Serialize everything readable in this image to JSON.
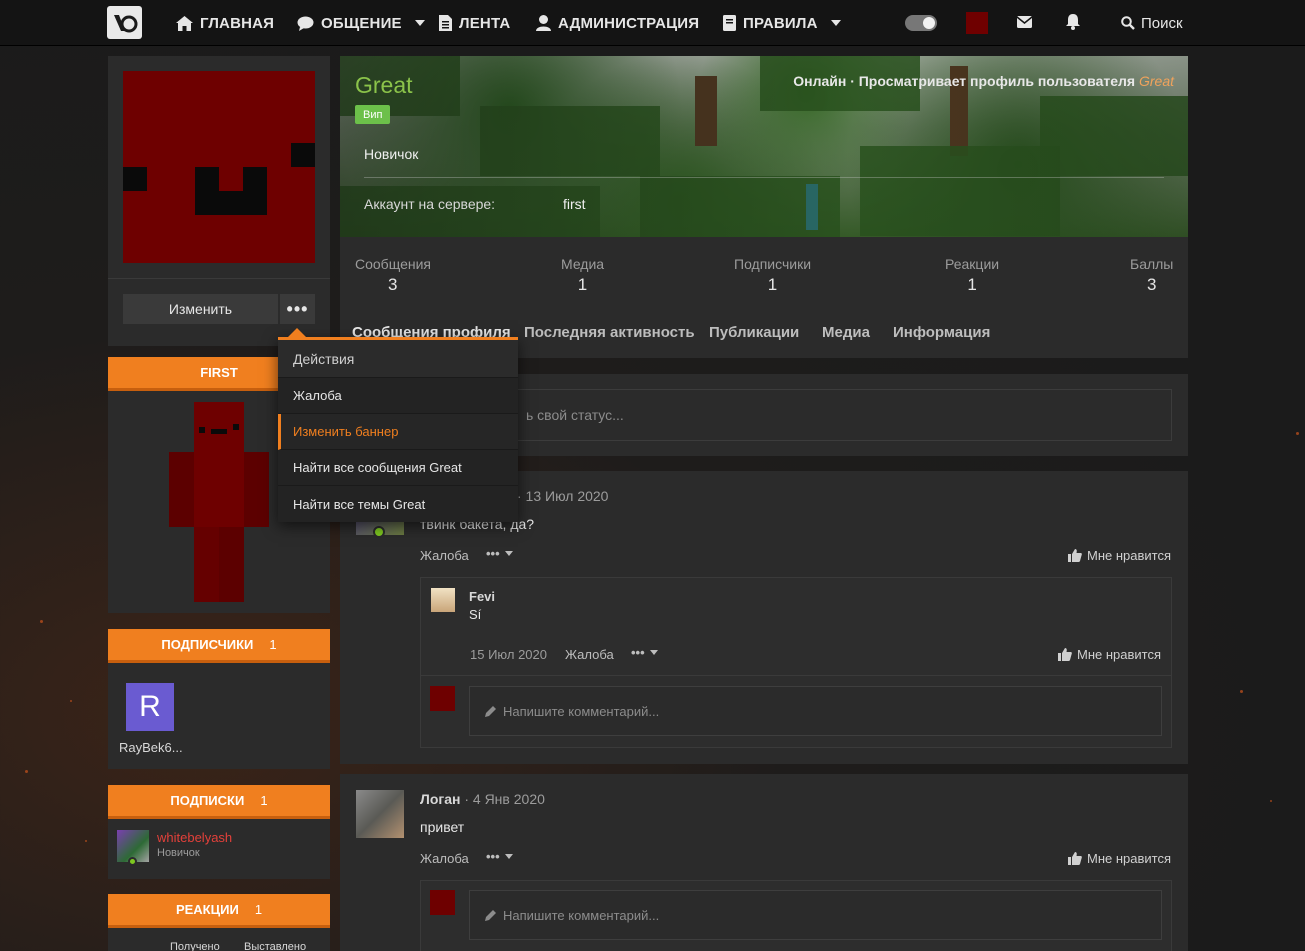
{
  "nav": {
    "home": "ГЛАВНАЯ",
    "chat": "ОБЩЕНИЕ",
    "feed": "ЛЕНТА",
    "admin": "АДМИНИСТРАЦИЯ",
    "rules": "ПРАВИЛА",
    "search": "Поиск"
  },
  "profile": {
    "username": "Great",
    "badge": "Вип",
    "rank": "Новичок",
    "online_prefix": "Онлайн · Просматривает профиль пользователя",
    "online_user": "Great",
    "server_label": "Аккаунт на сервере:",
    "server_value": "first",
    "edit_button": "Изменить",
    "more_button": "•••"
  },
  "stats": [
    {
      "label": "Сообщения",
      "value": "3"
    },
    {
      "label": "Медиа",
      "value": "1"
    },
    {
      "label": "Подписчики",
      "value": "1"
    },
    {
      "label": "Реакции",
      "value": "1"
    },
    {
      "label": "Баллы",
      "value": "3"
    }
  ],
  "tabs": [
    "Сообщения профиля",
    "Последняя активность",
    "Публикации",
    "Медиа",
    "Информация"
  ],
  "dropdown": {
    "header": "Действия",
    "items": [
      "Жалоба",
      "Изменить баннер",
      "Найти все сообщения Great",
      "Найти все темы Great"
    ]
  },
  "sidebar": {
    "skin_title": "FIRST",
    "followers_title": "ПОДПИСЧИКИ",
    "followers_count": "1",
    "follower_letter": "R",
    "follower_name": "RayBek6...",
    "following_title": "ПОДПИСКИ",
    "following_count": "1",
    "following_name": "whitebelyash",
    "following_rank": "Новичок",
    "reactions_title": "РЕАКЦИИ",
    "reactions_count": "1",
    "reactions_received": "Получено",
    "reactions_given": "Выставлено"
  },
  "status_placeholder": "ь свой статус...",
  "posts": [
    {
      "meta": "· 13 Июл 2020",
      "text": "твинк бакета, да?",
      "report": "Жалоба",
      "more": "•••",
      "like": "Мне нравится",
      "reply": {
        "author": "Fevi",
        "text": "Sí",
        "date": "15 Июл 2020",
        "report": "Жалоба",
        "more": "•••",
        "like": "Мне нравится"
      },
      "comment_placeholder": "Напишите комментарий..."
    },
    {
      "author": "Логан",
      "meta": "· 4 Янв 2020",
      "text": "привет",
      "report": "Жалоба",
      "more": "•••",
      "like": "Мне нравится",
      "comment_placeholder": "Напишите комментарий..."
    }
  ],
  "colors": {
    "accent": "#f07f1f",
    "username": "#8bc34a",
    "badge": "#6cc04a",
    "following_name": "#e2403a"
  }
}
